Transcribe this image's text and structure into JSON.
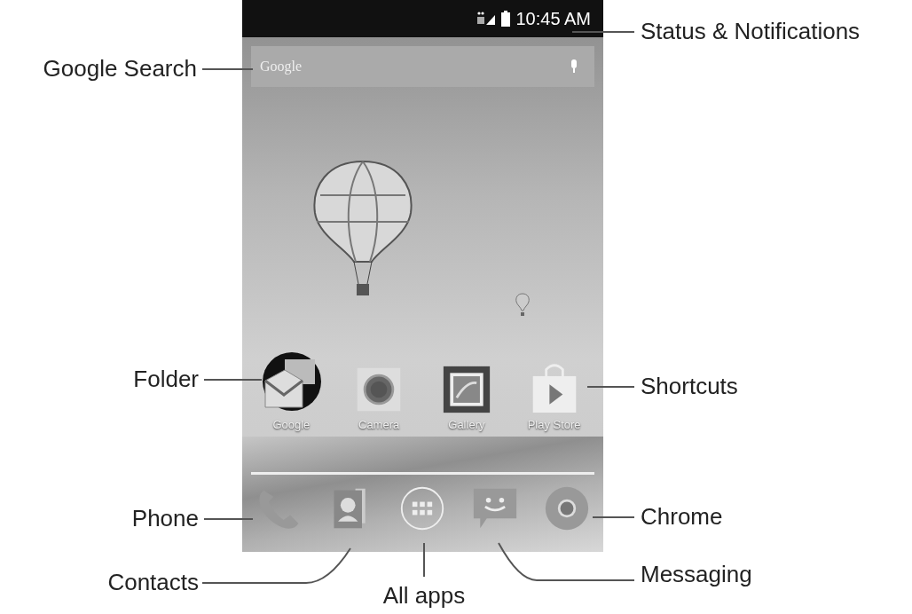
{
  "status_bar": {
    "time": "10:45 AM"
  },
  "search_bar": {
    "placeholder": "Google"
  },
  "shortcuts": [
    {
      "label": "Google",
      "kind": "folder"
    },
    {
      "label": "Camera",
      "kind": "camera"
    },
    {
      "label": "Gallery",
      "kind": "gallery"
    },
    {
      "label": "Play Store",
      "kind": "store"
    }
  ],
  "dock": [
    {
      "kind": "phone"
    },
    {
      "kind": "contacts"
    },
    {
      "kind": "apps"
    },
    {
      "kind": "messaging"
    },
    {
      "kind": "chrome"
    }
  ],
  "callouts": [
    {
      "label": "Status & Notifications"
    },
    {
      "label": "Google Search"
    },
    {
      "label": "Folder"
    },
    {
      "label": "Shortcuts"
    },
    {
      "label": "Phone"
    },
    {
      "label": "Chrome"
    },
    {
      "label": "Contacts"
    },
    {
      "label": "All apps"
    },
    {
      "label": "Messaging"
    }
  ]
}
